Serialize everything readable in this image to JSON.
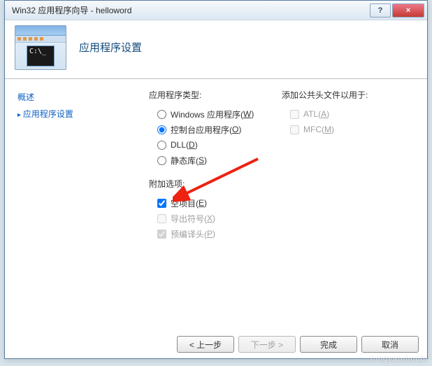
{
  "window": {
    "title": "Win32 应用程序向导 - helloword",
    "help": "?",
    "close": "×"
  },
  "header": {
    "title": "应用程序设置",
    "console_text": "C:\\_"
  },
  "sidebar": {
    "overview": "概述",
    "settings": "应用程序设置"
  },
  "apptype": {
    "label": "应用程序类型:",
    "windows_pre": "Windows 应用程序(",
    "windows_key": "W",
    "windows_post": ")",
    "console_pre": "控制台应用程序(",
    "console_key": "O",
    "console_post": ")",
    "dll_pre": "DLL(",
    "dll_key": "D",
    "dll_post": ")",
    "static_pre": "静态库(",
    "static_key": "S",
    "static_post": ")"
  },
  "add": {
    "label": "附加选项:",
    "empty_pre": "空项目(",
    "empty_key": "E",
    "empty_post": ")",
    "export_pre": "导出符号(",
    "export_key": "X",
    "export_post": ")",
    "precomp_pre": "预编译头(",
    "precomp_key": "P",
    "precomp_post": ")"
  },
  "common": {
    "label": "添加公共头文件以用于:",
    "atl_pre": "ATL(",
    "atl_key": "A",
    "atl_post": ")",
    "mfc_pre": "MFC(",
    "mfc_key": "M",
    "mfc_post": ")"
  },
  "buttons": {
    "prev": "< 上一步",
    "next": "下一步 >",
    "finish": "完成",
    "cancel": "取消"
  },
  "watermark": "jungyatuhunbi"
}
